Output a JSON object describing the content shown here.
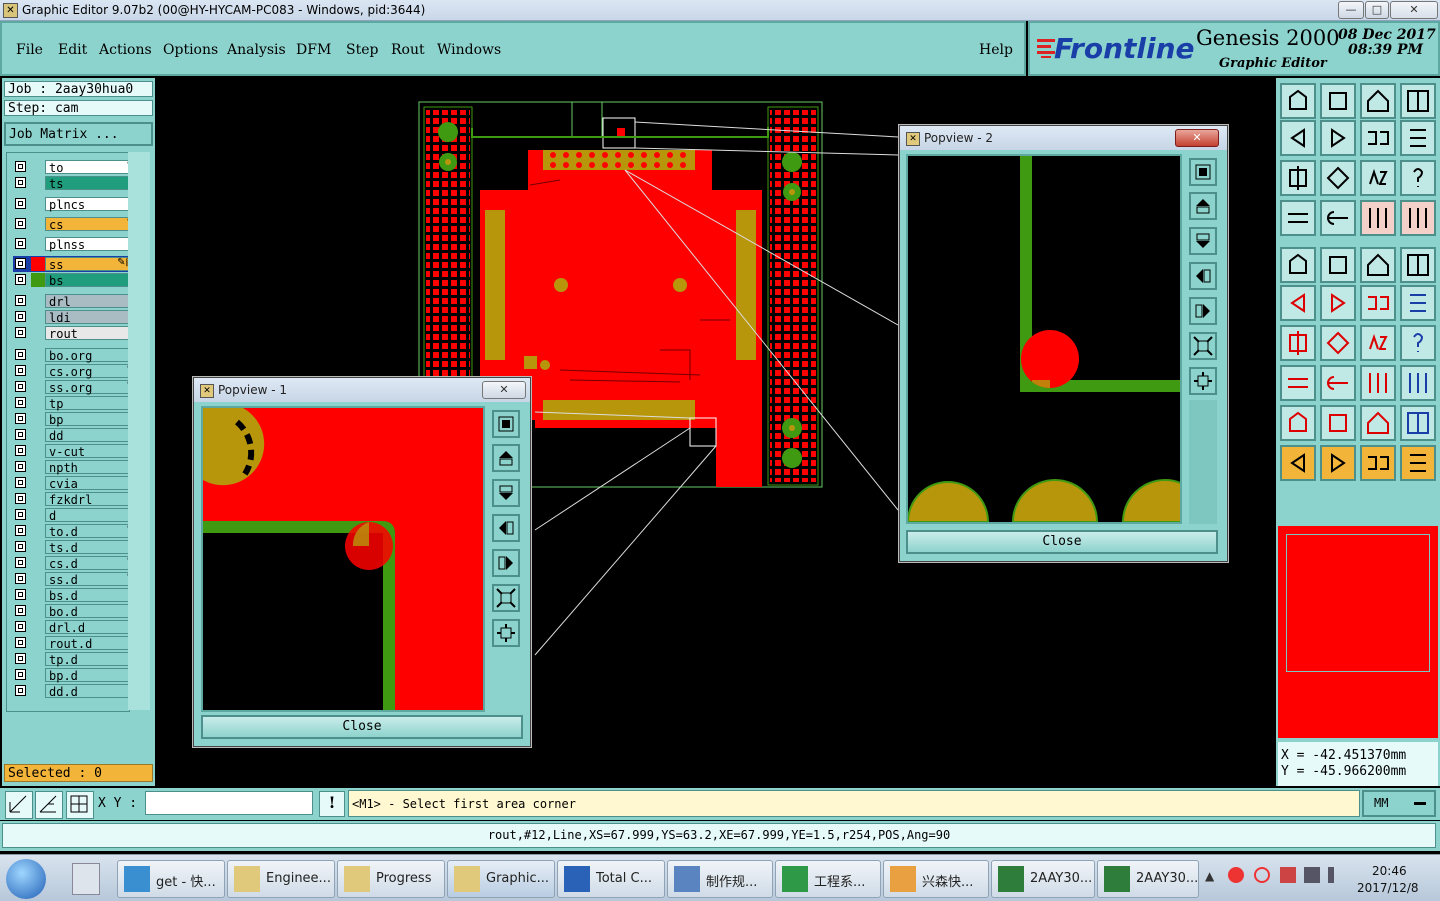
{
  "window": {
    "title": "Graphic Editor 9.07b2 (00@HY-HYCAM-PC083 - Windows, pid:3644)",
    "min": "—",
    "max": "□",
    "close": "✕"
  },
  "menu": {
    "items": [
      "File",
      "Edit",
      "Actions",
      "Options",
      "Analysis",
      "DFM",
      "Step",
      "Rout",
      "Windows"
    ],
    "help": "Help"
  },
  "brand": {
    "logo": "Frontline",
    "product": "Genesis 2000",
    "subtitle": "Graphic Editor",
    "date": "08 Dec 2017",
    "time": "08:39 PM"
  },
  "job": {
    "job": "Job : 2aay30hua0",
    "step": "Step: cam",
    "matrix_button": "Job Matrix ..."
  },
  "layers": [
    {
      "name": "to",
      "color": "#ffffff",
      "marker": "edit"
    },
    {
      "name": "ts",
      "color": "#1f9d7c",
      "marker": ""
    },
    {
      "name": "plncs",
      "color": "#ffffff",
      "marker": ""
    },
    {
      "name": "cs",
      "color": "#f3b43a",
      "marker": "edit"
    },
    {
      "name": "plnss",
      "color": "#ffffff",
      "marker": ""
    },
    {
      "name": "ss",
      "color": "#f3b43a",
      "marker": "edit-work"
    },
    {
      "name": "bs",
      "color": "#1f9d7c",
      "marker": ""
    },
    {
      "name": "drl",
      "color": "#a9bcc4",
      "marker": ""
    },
    {
      "name": "ldi",
      "color": "#a9bcc4",
      "marker": ""
    },
    {
      "name": "rout",
      "color": "#e8e8e8",
      "marker": ""
    },
    {
      "name": "bo.org",
      "color": "#8dd3cd",
      "marker": ""
    },
    {
      "name": "cs.org",
      "color": "#8dd3cd",
      "marker": "edit"
    },
    {
      "name": "ss.org",
      "color": "#8dd3cd",
      "marker": "edit"
    },
    {
      "name": "tp",
      "color": "#8dd3cd",
      "marker": ""
    },
    {
      "name": "bp",
      "color": "#8dd3cd",
      "marker": ""
    },
    {
      "name": "dd",
      "color": "#8dd3cd",
      "marker": ""
    },
    {
      "name": "v-cut",
      "color": "#8dd3cd",
      "marker": ""
    },
    {
      "name": "npth",
      "color": "#8dd3cd",
      "marker": ""
    },
    {
      "name": "cvia",
      "color": "#8dd3cd",
      "marker": ""
    },
    {
      "name": "fzkdrl",
      "color": "#8dd3cd",
      "marker": ""
    },
    {
      "name": "d",
      "color": "#8dd3cd",
      "marker": ""
    },
    {
      "name": "to.d",
      "color": "#8dd3cd",
      "marker": "edit"
    },
    {
      "name": "ts.d",
      "color": "#8dd3cd",
      "marker": ""
    },
    {
      "name": "cs.d",
      "color": "#8dd3cd",
      "marker": "edit"
    },
    {
      "name": "ss.d",
      "color": "#8dd3cd",
      "marker": "edit"
    },
    {
      "name": "bs.d",
      "color": "#8dd3cd",
      "marker": ""
    },
    {
      "name": "bo.d",
      "color": "#8dd3cd",
      "marker": ""
    },
    {
      "name": "drl.d",
      "color": "#8dd3cd",
      "marker": ""
    },
    {
      "name": "rout.d",
      "color": "#8dd3cd",
      "marker": ""
    },
    {
      "name": "tp.d",
      "color": "#8dd3cd",
      "marker": ""
    },
    {
      "name": "bp.d",
      "color": "#8dd3cd",
      "marker": ""
    },
    {
      "name": "dd.d",
      "color": "#8dd3cd",
      "marker": ""
    }
  ],
  "selected": "Selected : 0",
  "popview1": {
    "title": "Popview - 1",
    "close_label": "Close"
  },
  "popview2": {
    "title": "Popview - 2",
    "close_label": "Close"
  },
  "coords": {
    "x": "X  =  -42.451370mm",
    "y": "Y  =  -45.966200mm"
  },
  "command": {
    "xy_label": "X Y :",
    "xy_value": "",
    "prompt": "<M1> - Select first area corner",
    "units": "MM",
    "bang": "!"
  },
  "status": "rout,#12,Line,XS=67.999,YS=63.2,XE=67.999,YE=1.5,r254,POS,Ang=90",
  "taskbar": {
    "items": [
      "get - 快...",
      "Enginee...",
      "Progress",
      "Graphic...",
      "Total C...",
      "制作规...",
      "工程系...",
      "兴森快...",
      "2AAY30...",
      "2AAY30..."
    ],
    "time": "20:46",
    "date": "2017/12/8"
  },
  "colors": {
    "panel": "#8dd3cd",
    "copper": "#ff0000",
    "pad": "#b8960c",
    "trace": "#3f9a12",
    "highlight": "#f3b43a"
  }
}
